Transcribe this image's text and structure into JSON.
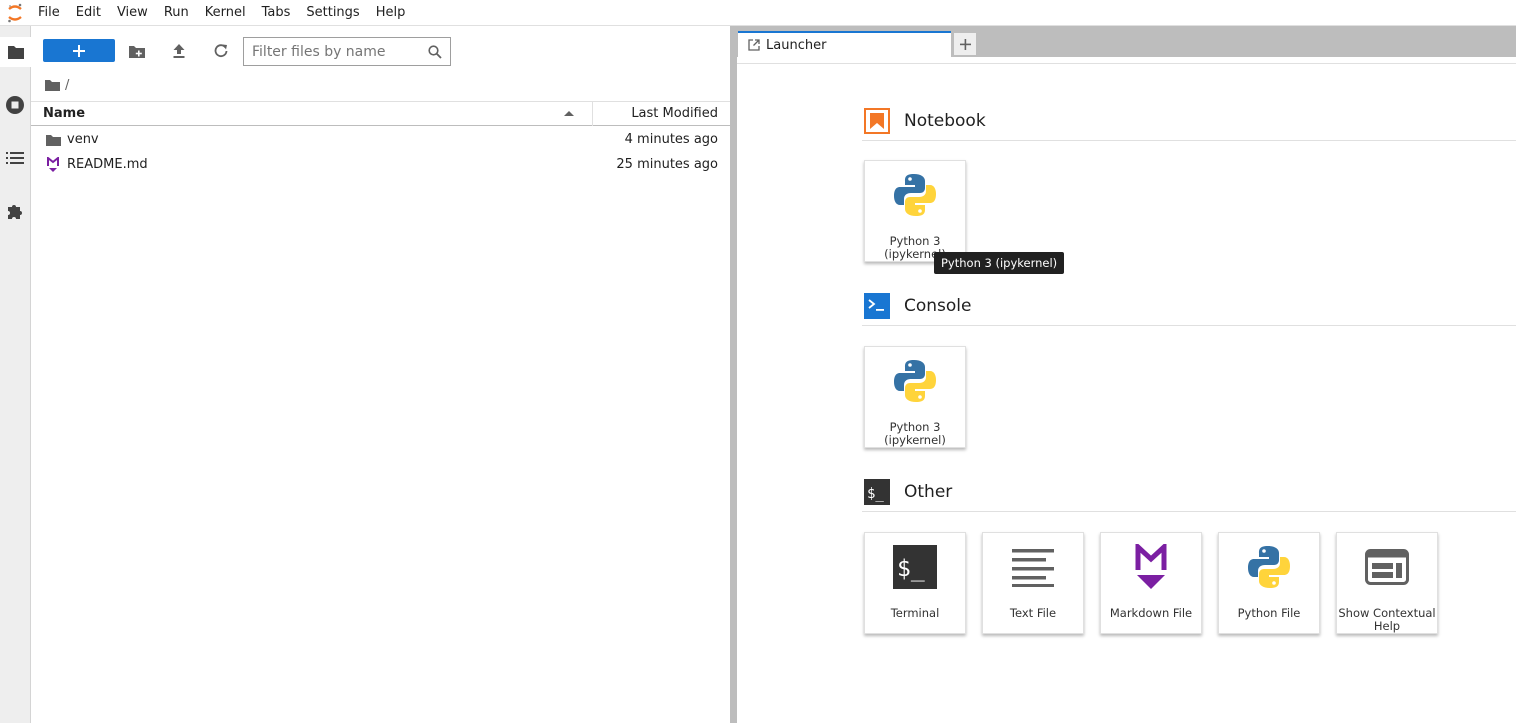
{
  "menubar": {
    "items": [
      "File",
      "Edit",
      "View",
      "Run",
      "Kernel",
      "Tabs",
      "Settings",
      "Help"
    ]
  },
  "filebrowser": {
    "filter_placeholder": "Filter files by name",
    "breadcrumb": "/",
    "columns": {
      "name": "Name",
      "modified": "Last Modified"
    },
    "files": [
      {
        "name": "venv",
        "modified": "4 minutes ago",
        "icon": "folder-icon"
      },
      {
        "name": "README.md",
        "modified": "25 minutes ago",
        "icon": "markdown-file-icon"
      }
    ]
  },
  "tabs": {
    "active_tab": "Launcher"
  },
  "launcher": {
    "sections": {
      "notebook": {
        "title": "Notebook",
        "cards": [
          {
            "label": "Python 3 (ipykernel)"
          }
        ]
      },
      "console": {
        "title": "Console",
        "cards": [
          {
            "label": "Python 3 (ipykernel)"
          }
        ]
      },
      "other": {
        "title": "Other",
        "cards": [
          {
            "label": "Terminal"
          },
          {
            "label": "Text File"
          },
          {
            "label": "Markdown File"
          },
          {
            "label": "Python File"
          },
          {
            "label": "Show Contextual Help"
          }
        ]
      }
    },
    "tooltip": "Python 3 (ipykernel)"
  },
  "colors": {
    "accent": "#1976d2",
    "notebook_orange": "#f37726",
    "markdown_purple": "#7b1fa2",
    "python_blue": "#3572a5",
    "python_yellow": "#ffd43b"
  }
}
